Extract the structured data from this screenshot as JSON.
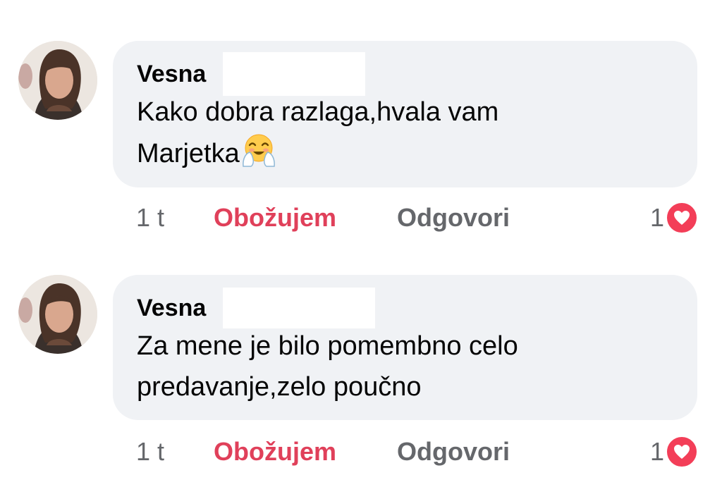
{
  "colors": {
    "bubble_bg": "#f0f2f5",
    "love_accent": "#e0405a",
    "muted_text": "#65676b",
    "heart_badge": "#f33e58"
  },
  "comments": [
    {
      "author": "Vesna",
      "text_line1": "Kako dobra razlaga,hvala vam",
      "text_line2": "Marjetka",
      "emoji_icon": "smiling-face-with-open-hands",
      "time": "1 t",
      "love_label": "Obožujem",
      "reply_label": "Odgovori",
      "reaction_count": "1",
      "reaction_icon": "heart-icon"
    },
    {
      "author": "Vesna",
      "text_line1": "Za mene je bilo pomembno celo",
      "text_line2": "predavanje,zelo poučno",
      "time": "1 t",
      "love_label": "Obožujem",
      "reply_label": "Odgovori",
      "reaction_count": "1",
      "reaction_icon": "heart-icon"
    }
  ]
}
